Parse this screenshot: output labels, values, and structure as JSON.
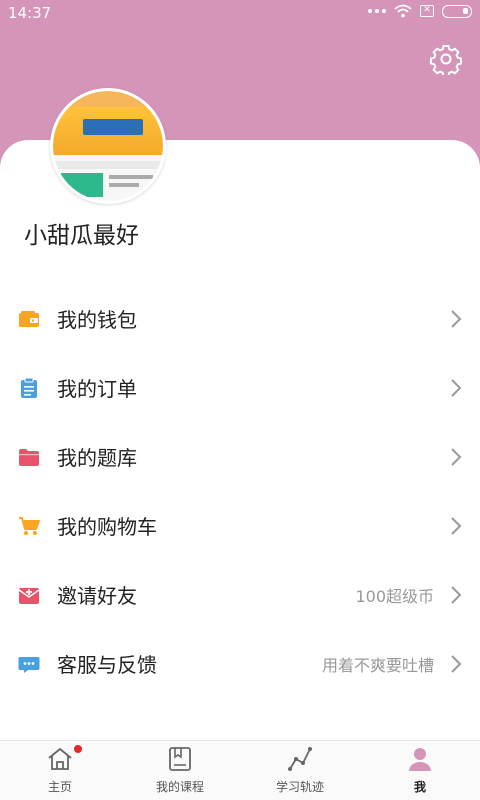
{
  "status_bar": {
    "time": "14:37"
  },
  "profile": {
    "username": "小甜瓜最好"
  },
  "menu": [
    {
      "label": "我的钱包",
      "value": "",
      "icon": "wallet-icon",
      "color": "#f6a623"
    },
    {
      "label": "我的订单",
      "value": "",
      "icon": "clipboard-icon",
      "color": "#4a9fde"
    },
    {
      "label": "我的题库",
      "value": "",
      "icon": "folder-icon",
      "color": "#e9536a"
    },
    {
      "label": "我的购物车",
      "value": "",
      "icon": "cart-icon",
      "color": "#f6a623"
    },
    {
      "label": "邀请好友",
      "value": "100超级币",
      "icon": "invite-mail-icon",
      "color": "#e9536a"
    },
    {
      "label": "客服与反馈",
      "value": "用着不爽要吐槽",
      "icon": "chat-icon",
      "color": "#4a9fde"
    }
  ],
  "tabs": [
    {
      "label": "主页",
      "icon": "home-icon",
      "badge": true
    },
    {
      "label": "我的课程",
      "icon": "course-book-icon",
      "badge": false
    },
    {
      "label": "学习轨迹",
      "icon": "track-icon",
      "badge": false
    },
    {
      "label": "我",
      "icon": "profile-icon",
      "active": true
    }
  ],
  "colors": {
    "header": "#d595b8",
    "badge": "#e8262c"
  }
}
